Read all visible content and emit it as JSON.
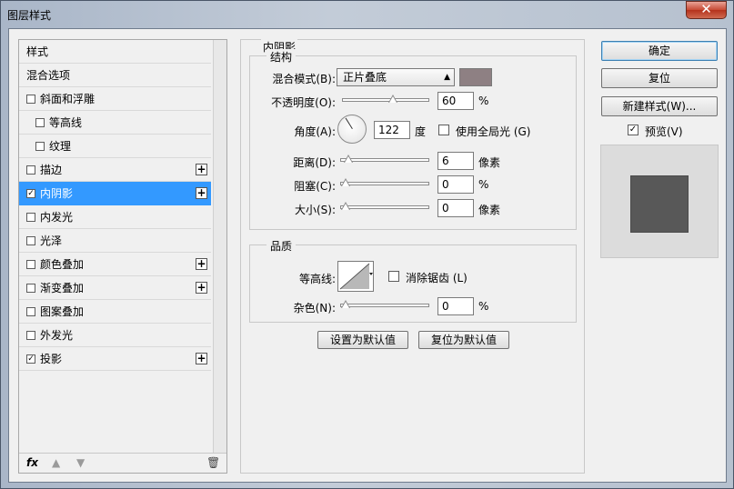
{
  "window": {
    "title": "图层样式",
    "close_label": "✕"
  },
  "left": {
    "items": [
      {
        "label": "样式",
        "checkbox": false,
        "checked": false,
        "plus": false,
        "indent": 0
      },
      {
        "label": "混合选项",
        "checkbox": false,
        "checked": false,
        "plus": false,
        "indent": 0
      },
      {
        "label": "斜面和浮雕",
        "checkbox": true,
        "checked": false,
        "plus": false,
        "indent": 0
      },
      {
        "label": "等高线",
        "checkbox": true,
        "checked": false,
        "plus": false,
        "indent": 1
      },
      {
        "label": "纹理",
        "checkbox": true,
        "checked": false,
        "plus": false,
        "indent": 1
      },
      {
        "label": "描边",
        "checkbox": true,
        "checked": false,
        "plus": true,
        "indent": 0
      },
      {
        "label": "内阴影",
        "checkbox": true,
        "checked": true,
        "plus": true,
        "indent": 0,
        "selected": true
      },
      {
        "label": "内发光",
        "checkbox": true,
        "checked": false,
        "plus": false,
        "indent": 0
      },
      {
        "label": "光泽",
        "checkbox": true,
        "checked": false,
        "plus": false,
        "indent": 0
      },
      {
        "label": "颜色叠加",
        "checkbox": true,
        "checked": false,
        "plus": true,
        "indent": 0
      },
      {
        "label": "渐变叠加",
        "checkbox": true,
        "checked": false,
        "plus": true,
        "indent": 0
      },
      {
        "label": "图案叠加",
        "checkbox": true,
        "checked": false,
        "plus": false,
        "indent": 0
      },
      {
        "label": "外发光",
        "checkbox": true,
        "checked": false,
        "plus": false,
        "indent": 0
      },
      {
        "label": "投影",
        "checkbox": true,
        "checked": true,
        "plus": true,
        "indent": 0
      }
    ],
    "fx_label": "fx",
    "up_icon": "▲",
    "down_icon": "▼",
    "trash_icon": "🗑"
  },
  "inner_shadow": {
    "title": "内阴影",
    "structure": {
      "legend": "结构",
      "blend_label": "混合模式(B):",
      "blend_value": "正片叠底",
      "blend_color": "#8e8083",
      "opacity_label": "不透明度(O):",
      "opacity_value": "60",
      "opacity_unit": "%",
      "opacity_level": 0.6,
      "angle_label": "角度(A):",
      "angle_value": "122",
      "angle_unit": "度",
      "global_light_label": "使用全局光 (G)",
      "global_light_checked": false,
      "distance_label": "距离(D):",
      "distance_value": "6",
      "distance_unit": "像素",
      "distance_level": 0.03,
      "choke_label": "阻塞(C):",
      "choke_value": "0",
      "choke_unit": "%",
      "choke_level": 0,
      "size_label": "大小(S):",
      "size_value": "0",
      "size_unit": "像素",
      "size_level": 0
    },
    "quality": {
      "legend": "品质",
      "contour_label": "等高线:",
      "antialias_label": "消除锯齿 (L)",
      "antialias_checked": false,
      "noise_label": "杂色(N):",
      "noise_value": "0",
      "noise_unit": "%",
      "noise_level": 0
    },
    "set_default_label": "设置为默认值",
    "reset_default_label": "复位为默认值"
  },
  "right": {
    "ok_label": "确定",
    "reset_label": "复位",
    "new_style_label": "新建样式(W)...",
    "preview_label": "预览(V)",
    "preview_checked": true
  }
}
